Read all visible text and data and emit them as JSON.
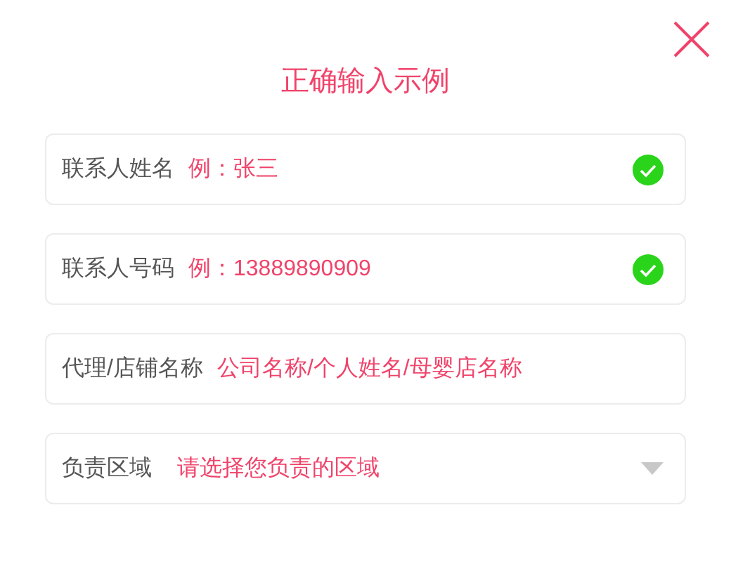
{
  "title": "正确输入示例",
  "fields": [
    {
      "kind": "text",
      "label": "联系人姓名",
      "value": "例：张三",
      "valid": true
    },
    {
      "kind": "text",
      "label": "联系人号码",
      "value": "例：13889890909",
      "valid": true
    },
    {
      "kind": "text",
      "label": "代理/店铺名称",
      "value": "公司名称/个人姓名/母婴店名称",
      "valid": false
    },
    {
      "kind": "select",
      "label": "负责区域",
      "value": "请选择您负责的区域"
    }
  ]
}
